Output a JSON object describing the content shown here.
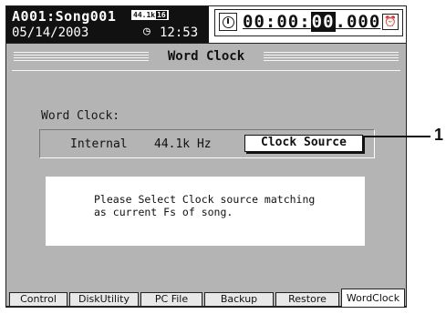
{
  "header": {
    "song": "A001:Song001",
    "date": "05/14/2003",
    "sample_rate_badge": "44.1k",
    "bit_depth_badge": "16",
    "clock_time": "12:53",
    "counter_prefix": "00:00:",
    "counter_selected": "00",
    "counter_suffix": ".000",
    "clock_icon": "clock-icon",
    "alarm_icon": "alarm-clock-icon"
  },
  "page": {
    "title": "Word Clock"
  },
  "word_clock": {
    "label": "Word Clock:",
    "source": "Internal",
    "rate": "44.1k Hz",
    "button_label": "Clock Source"
  },
  "message": {
    "line1": "Please Select Clock source matching",
    "line2": "as current Fs of song."
  },
  "tabs": [
    {
      "label": "Control",
      "active": false
    },
    {
      "label": "DiskUtility",
      "active": false
    },
    {
      "label": "PC File",
      "active": false
    },
    {
      "label": "Backup",
      "active": false
    },
    {
      "label": "Restore",
      "active": false
    },
    {
      "label": "WordClock",
      "active": true
    }
  ],
  "callout": {
    "number": "1"
  }
}
